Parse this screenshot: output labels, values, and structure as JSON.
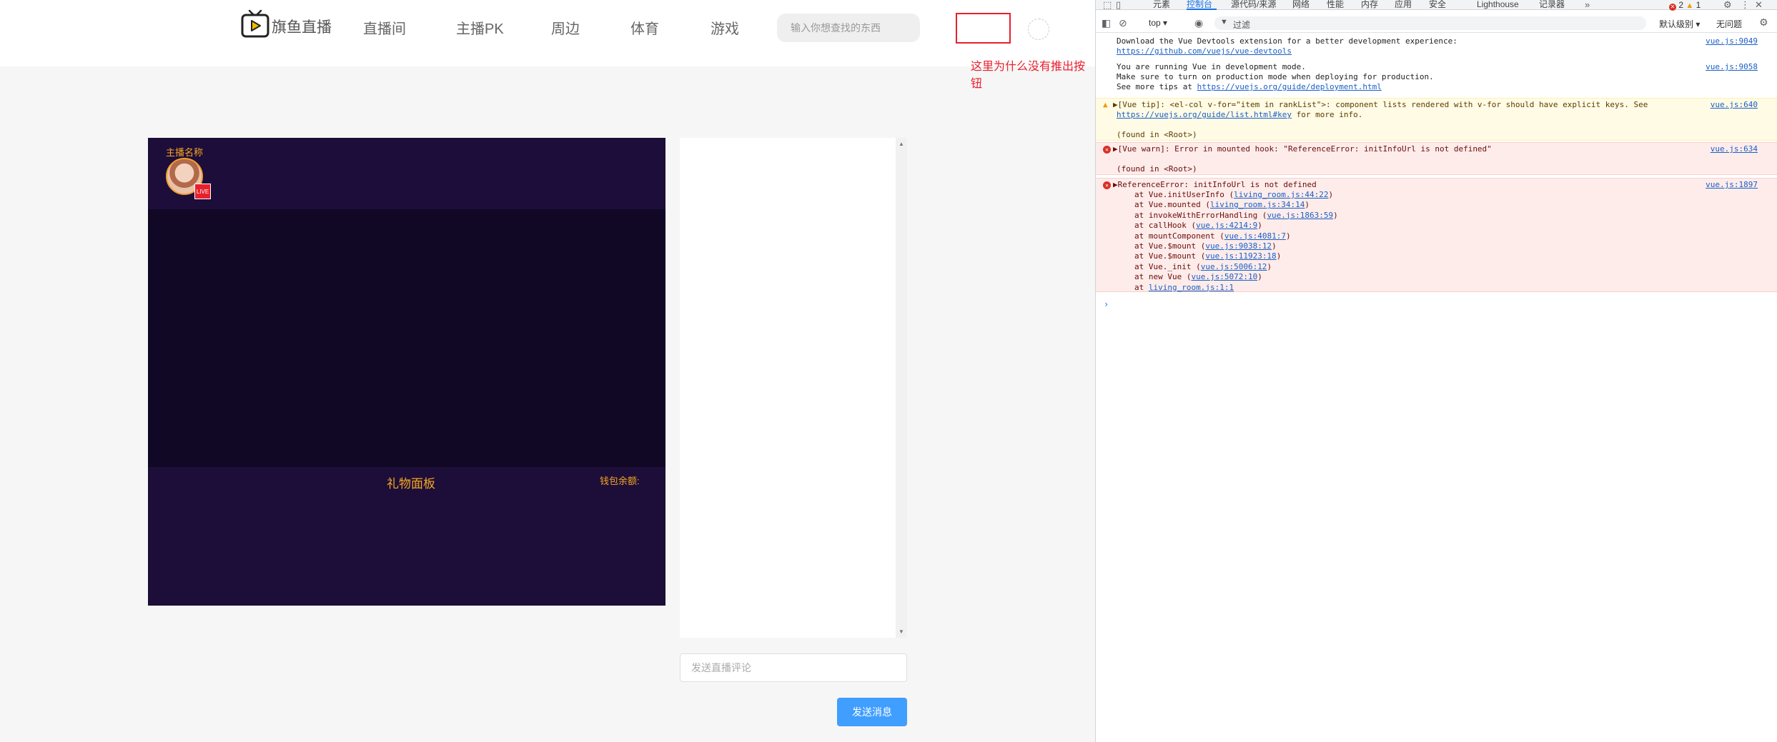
{
  "webpage": {
    "logo_text": "旗鱼直播",
    "nav": [
      "直播间",
      "主播PK",
      "周边",
      "体育",
      "游戏"
    ],
    "search_placeholder": "输入你想查找的东西",
    "annotation": "这里为什么没有推出按钮",
    "player": {
      "anchor_name": "主播名称",
      "live_badge": "LIVE",
      "gift_title": "礼物面板",
      "wallet_label": "钱包余额:"
    },
    "comment_placeholder": "发送直播评论",
    "send_button": "发送消息",
    "colors": {
      "accent": "#f5a623",
      "player_bg": "#1c0e38",
      "button": "#409eff",
      "annotation": "#e8202d"
    }
  },
  "devtools": {
    "tabs": [
      "元素",
      "控制台",
      "源代码/来源",
      "网络",
      "性能",
      "内存",
      "应用",
      "安全",
      "Lighthouse",
      "记录器"
    ],
    "active_tab": "控制台",
    "error_count": "2",
    "warning_count": "1",
    "context": "top",
    "filter_placeholder": "过滤",
    "level": "默认级别",
    "issues": "无问题",
    "messages": [
      {
        "type": "log",
        "lines": [
          "Download the Vue Devtools extension for a better development experience:"
        ],
        "link": "https://github.com/vuejs/vue-devtools",
        "source": "vue.js:9049"
      },
      {
        "type": "log",
        "lines": [
          "You are running Vue in development mode.",
          "Make sure to turn on production mode when deploying for production."
        ],
        "tail_prefix": "See more tips at ",
        "link": "https://vuejs.org/guide/deployment.html",
        "source": "vue.js:9058"
      },
      {
        "type": "warn",
        "line1": "▶[Vue tip]: <el-col v-for=\"item in rankList\">: component lists rendered with v-for should have explicit keys. See",
        "link": "https://vuejs.org/guide/list.html#key",
        "link_suffix": " for more info.",
        "found": "(found in <Root>)",
        "source": "vue.js:640"
      },
      {
        "type": "error",
        "line1": "▶[Vue warn]: Error in mounted hook: \"ReferenceError: initInfoUrl is not defined\"",
        "found": "(found in <Root>)",
        "source": "vue.js:634"
      },
      {
        "type": "error",
        "line1": "▶ReferenceError: initInfoUrl is not defined",
        "source": "vue.js:1897",
        "stack": [
          {
            "at": "at Vue.initUserInfo (",
            "link": "living_room.js:44:22",
            "end": ")"
          },
          {
            "at": "at Vue.mounted (",
            "link": "living_room.js:34:14",
            "end": ")"
          },
          {
            "at": "at invokeWithErrorHandling (",
            "link": "vue.js:1863:59",
            "end": ")"
          },
          {
            "at": "at callHook (",
            "link": "vue.js:4214:9",
            "end": ")"
          },
          {
            "at": "at mountComponent (",
            "link": "vue.js:4081:7",
            "end": ")"
          },
          {
            "at": "at Vue.$mount (",
            "link": "vue.js:9038:12",
            "end": ")"
          },
          {
            "at": "at Vue.$mount (",
            "link": "vue.js:11923:18",
            "end": ")"
          },
          {
            "at": "at Vue._init (",
            "link": "vue.js:5006:12",
            "end": ")"
          },
          {
            "at": "at new Vue (",
            "link": "vue.js:5072:10",
            "end": ")"
          },
          {
            "at": "at ",
            "link": "living_room.js:1:1",
            "end": ""
          }
        ]
      }
    ],
    "prompt": "›"
  }
}
